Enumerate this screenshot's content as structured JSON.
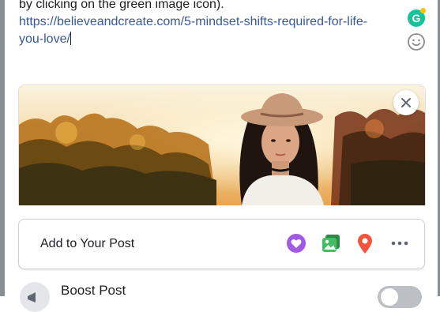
{
  "post": {
    "text_line1": "by clicking on the green image icon).",
    "link_line1": "https://believeandcreate.com/5-mindset-shifts-required-for-life-",
    "link_line2": "you-love/"
  },
  "grammarly": {
    "letter": "G",
    "color": "#15c39a",
    "badge_color": "#ffc107"
  },
  "emoji": {
    "icon": "smiley-icon"
  },
  "link_preview": {
    "image": "woman-in-hat-sunset-photo",
    "close_icon": "close-icon"
  },
  "add_to_post": {
    "label": "Add to Your Post",
    "tools": [
      {
        "icon": "activity-heart-icon",
        "color": "#a259e6"
      },
      {
        "icon": "photo-video-icon",
        "color": "#45bd62"
      },
      {
        "icon": "location-pin-icon",
        "color": "#f5533d"
      },
      {
        "icon": "more-icon",
        "color": "#606770"
      }
    ]
  },
  "boost": {
    "label": "Boost Post",
    "enabled": false
  }
}
